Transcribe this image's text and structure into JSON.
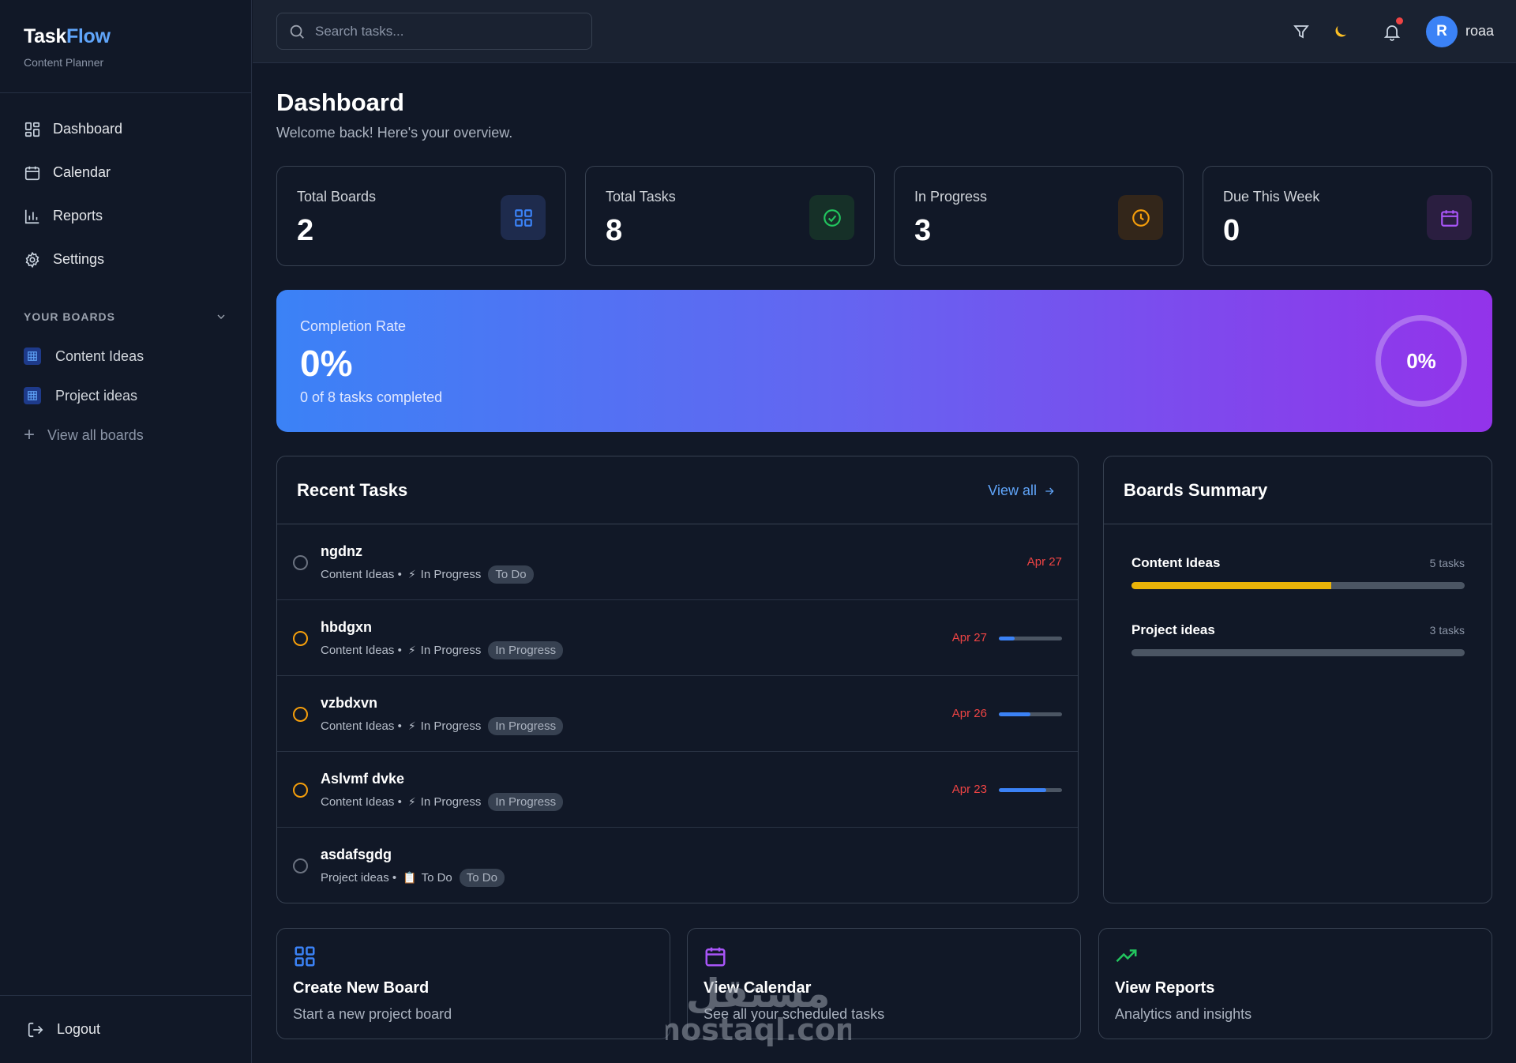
{
  "brand": {
    "name_part1": "Task",
    "name_part2": "Flow",
    "subtitle": "Content Planner"
  },
  "sidebar": {
    "nav": [
      {
        "label": "Dashboard",
        "icon": "grid-icon"
      },
      {
        "label": "Calendar",
        "icon": "calendar-icon"
      },
      {
        "label": "Reports",
        "icon": "bar-chart-icon"
      },
      {
        "label": "Settings",
        "icon": "gear-icon"
      }
    ],
    "boards_title": "YOUR BOARDS",
    "boards": [
      {
        "label": "Content Ideas"
      },
      {
        "label": "Project ideas"
      }
    ],
    "view_all_boards": "View all boards",
    "logout": "Logout"
  },
  "topbar": {
    "search_placeholder": "Search tasks...",
    "avatar_initial": "R",
    "username": "roaa"
  },
  "page": {
    "title": "Dashboard",
    "subtitle": "Welcome back! Here's your overview."
  },
  "stats": [
    {
      "label": "Total Boards",
      "value": "2",
      "icon": "grid-icon",
      "color": "#3b82f6"
    },
    {
      "label": "Total Tasks",
      "value": "8",
      "icon": "check-circle-icon",
      "color": "#22c55e"
    },
    {
      "label": "In Progress",
      "value": "3",
      "icon": "clock-icon",
      "color": "#f59e0b"
    },
    {
      "label": "Due This Week",
      "value": "0",
      "icon": "calendar-icon",
      "color": "#a855f7"
    }
  ],
  "completion": {
    "label": "Completion Rate",
    "value": "0%",
    "subtitle": "0 of 8 tasks completed",
    "ring_value": "0%"
  },
  "recent_tasks": {
    "title": "Recent Tasks",
    "view_all": "View all",
    "tasks": [
      {
        "title": "ngdnz",
        "board": "Content Ideas",
        "emoji": "⚡",
        "status": "In Progress",
        "tag": "To Do",
        "date": "Apr 27",
        "progress": null,
        "check": "todo"
      },
      {
        "title": "hbdgxn",
        "board": "Content Ideas",
        "emoji": "⚡",
        "status": "In Progress",
        "tag": "In Progress",
        "date": "Apr 27",
        "progress": 0.25,
        "check": "inprog"
      },
      {
        "title": "vzbdxvn",
        "board": "Content Ideas",
        "emoji": "⚡",
        "status": "In Progress",
        "tag": "In Progress",
        "date": "Apr 26",
        "progress": 0.5,
        "check": "inprog"
      },
      {
        "title": "Aslvmf dvke",
        "board": "Content Ideas",
        "emoji": "⚡",
        "status": "In Progress",
        "tag": "In Progress",
        "date": "Apr 23",
        "progress": 0.75,
        "check": "inprog"
      },
      {
        "title": "asdafsgdg",
        "board": "Project ideas",
        "emoji": "📋",
        "status": "To Do",
        "tag": "To Do",
        "date": "",
        "progress": null,
        "check": "todo"
      }
    ]
  },
  "boards_summary": {
    "title": "Boards Summary",
    "items": [
      {
        "name": "Content Ideas",
        "count": "5 tasks",
        "fill": 0.6,
        "color": "#eab308"
      },
      {
        "name": "Project ideas",
        "count": "3 tasks",
        "fill": 0,
        "color": "#eab308"
      }
    ]
  },
  "actions": [
    {
      "title": "Create New Board",
      "subtitle": "Start a new project board",
      "icon": "grid-icon",
      "color": "#3b82f6"
    },
    {
      "title": "View Calendar",
      "subtitle": "See all your scheduled tasks",
      "icon": "calendar-icon",
      "color": "#a855f7"
    },
    {
      "title": "View Reports",
      "subtitle": "Analytics and insights",
      "icon": "trending-up-icon",
      "color": "#22c55e"
    }
  ],
  "watermark": {
    "arabic": "مستقل",
    "latin": "mostaql.com"
  }
}
